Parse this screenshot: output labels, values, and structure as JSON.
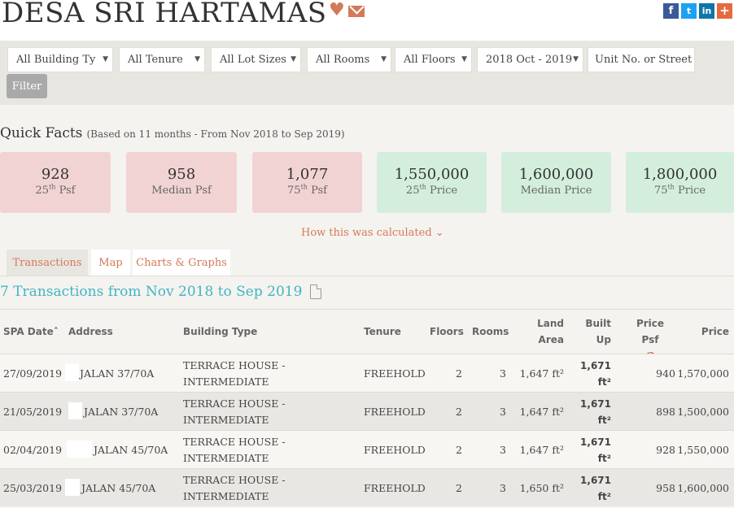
{
  "header": {
    "title": "DESA SRI HARTAMAS",
    "icons": [
      "heart-icon",
      "mail-icon"
    ],
    "social": [
      {
        "name": "facebook",
        "glyph": "f"
      },
      {
        "name": "twitter",
        "glyph": "t"
      },
      {
        "name": "linkedin",
        "glyph": "in"
      },
      {
        "name": "google-plus",
        "glyph": "+"
      }
    ]
  },
  "filters": {
    "building_type": "All Building Ty",
    "tenure": "All Tenure",
    "lot_sizes": "All Lot Sizes",
    "rooms": "All Rooms",
    "floors": "All Floors",
    "date_range": "2018 Oct - 2019",
    "unit_placeholder": "Unit No. or Street",
    "filter_button": "Filter"
  },
  "quick_facts": {
    "title": "Quick Facts",
    "subtitle": "(Based on 11 months - From Nov 2018 to Sep 2019)",
    "cards": [
      {
        "value": "928",
        "label_pre": "25",
        "label_sup": "th",
        "label_post": " Psf",
        "color": "#f2d3d4"
      },
      {
        "value": "958",
        "label_pre": "Median Psf",
        "label_sup": "",
        "label_post": "",
        "color": "#f2d3d4"
      },
      {
        "value": "1,077",
        "label_pre": "75",
        "label_sup": "th",
        "label_post": " Psf",
        "color": "#f2d3d4"
      },
      {
        "value": "1,550,000",
        "label_pre": "25",
        "label_sup": "th",
        "label_post": " Price",
        "color": "#d3eedd"
      },
      {
        "value": "1,600,000",
        "label_pre": "Median Price",
        "label_sup": "",
        "label_post": "",
        "color": "#d3eedd"
      },
      {
        "value": "1,800,000",
        "label_pre": "75",
        "label_sup": "th",
        "label_post": " Price",
        "color": "#d3eedd"
      }
    ],
    "how_calculated": "How this was calculated ⌄"
  },
  "tabs": [
    "Transactions",
    "Map",
    "Charts & Graphs"
  ],
  "transactions": {
    "title": "7 Transactions from Nov 2018 to Sep 2019",
    "columns": {
      "spa_date": "SPA Date˄",
      "address": "Address",
      "building_type": "Building Type",
      "tenure": "Tenure",
      "floors": "Floors",
      "rooms": "Rooms",
      "land_area_1": "Land",
      "land_area_2": "Area",
      "built_up_1": "Built",
      "built_up_2": "Up",
      "price_psf": "Price Psf",
      "price": "Price"
    },
    "rows": [
      {
        "date": "27/09/2019",
        "address": "JALAN 37/70A",
        "type1": "TERRACE HOUSE -",
        "type2": "INTERMEDIATE",
        "tenure": "FREEHOLD",
        "floors": "2",
        "rooms": "3",
        "land": "1,647 ft²",
        "built1": "1,671",
        "built2": "ft²",
        "psf": "940",
        "price": "1,570,000"
      },
      {
        "date": "21/05/2019",
        "address": "JALAN 37/70A",
        "type1": "TERRACE HOUSE -",
        "type2": "INTERMEDIATE",
        "tenure": "FREEHOLD",
        "floors": "2",
        "rooms": "3",
        "land": "1,647 ft²",
        "built1": "1,671",
        "built2": "ft²",
        "psf": "898",
        "price": "1,500,000"
      },
      {
        "date": "02/04/2019",
        "address": "JALAN 45/70A",
        "type1": "TERRACE HOUSE -",
        "type2": "INTERMEDIATE",
        "tenure": "FREEHOLD",
        "floors": "2",
        "rooms": "3",
        "land": "1,647 ft²",
        "built1": "1,671",
        "built2": "ft²",
        "psf": "928",
        "price": "1,550,000"
      },
      {
        "date": "25/03/2019",
        "address": "JALAN 45/70A",
        "type1": "TERRACE HOUSE -",
        "type2": "INTERMEDIATE",
        "tenure": "FREEHOLD",
        "floors": "2",
        "rooms": "3",
        "land": "1,650 ft²",
        "built1": "1,671",
        "built2": "ft²",
        "psf": "958",
        "price": "1,600,000"
      }
    ]
  }
}
